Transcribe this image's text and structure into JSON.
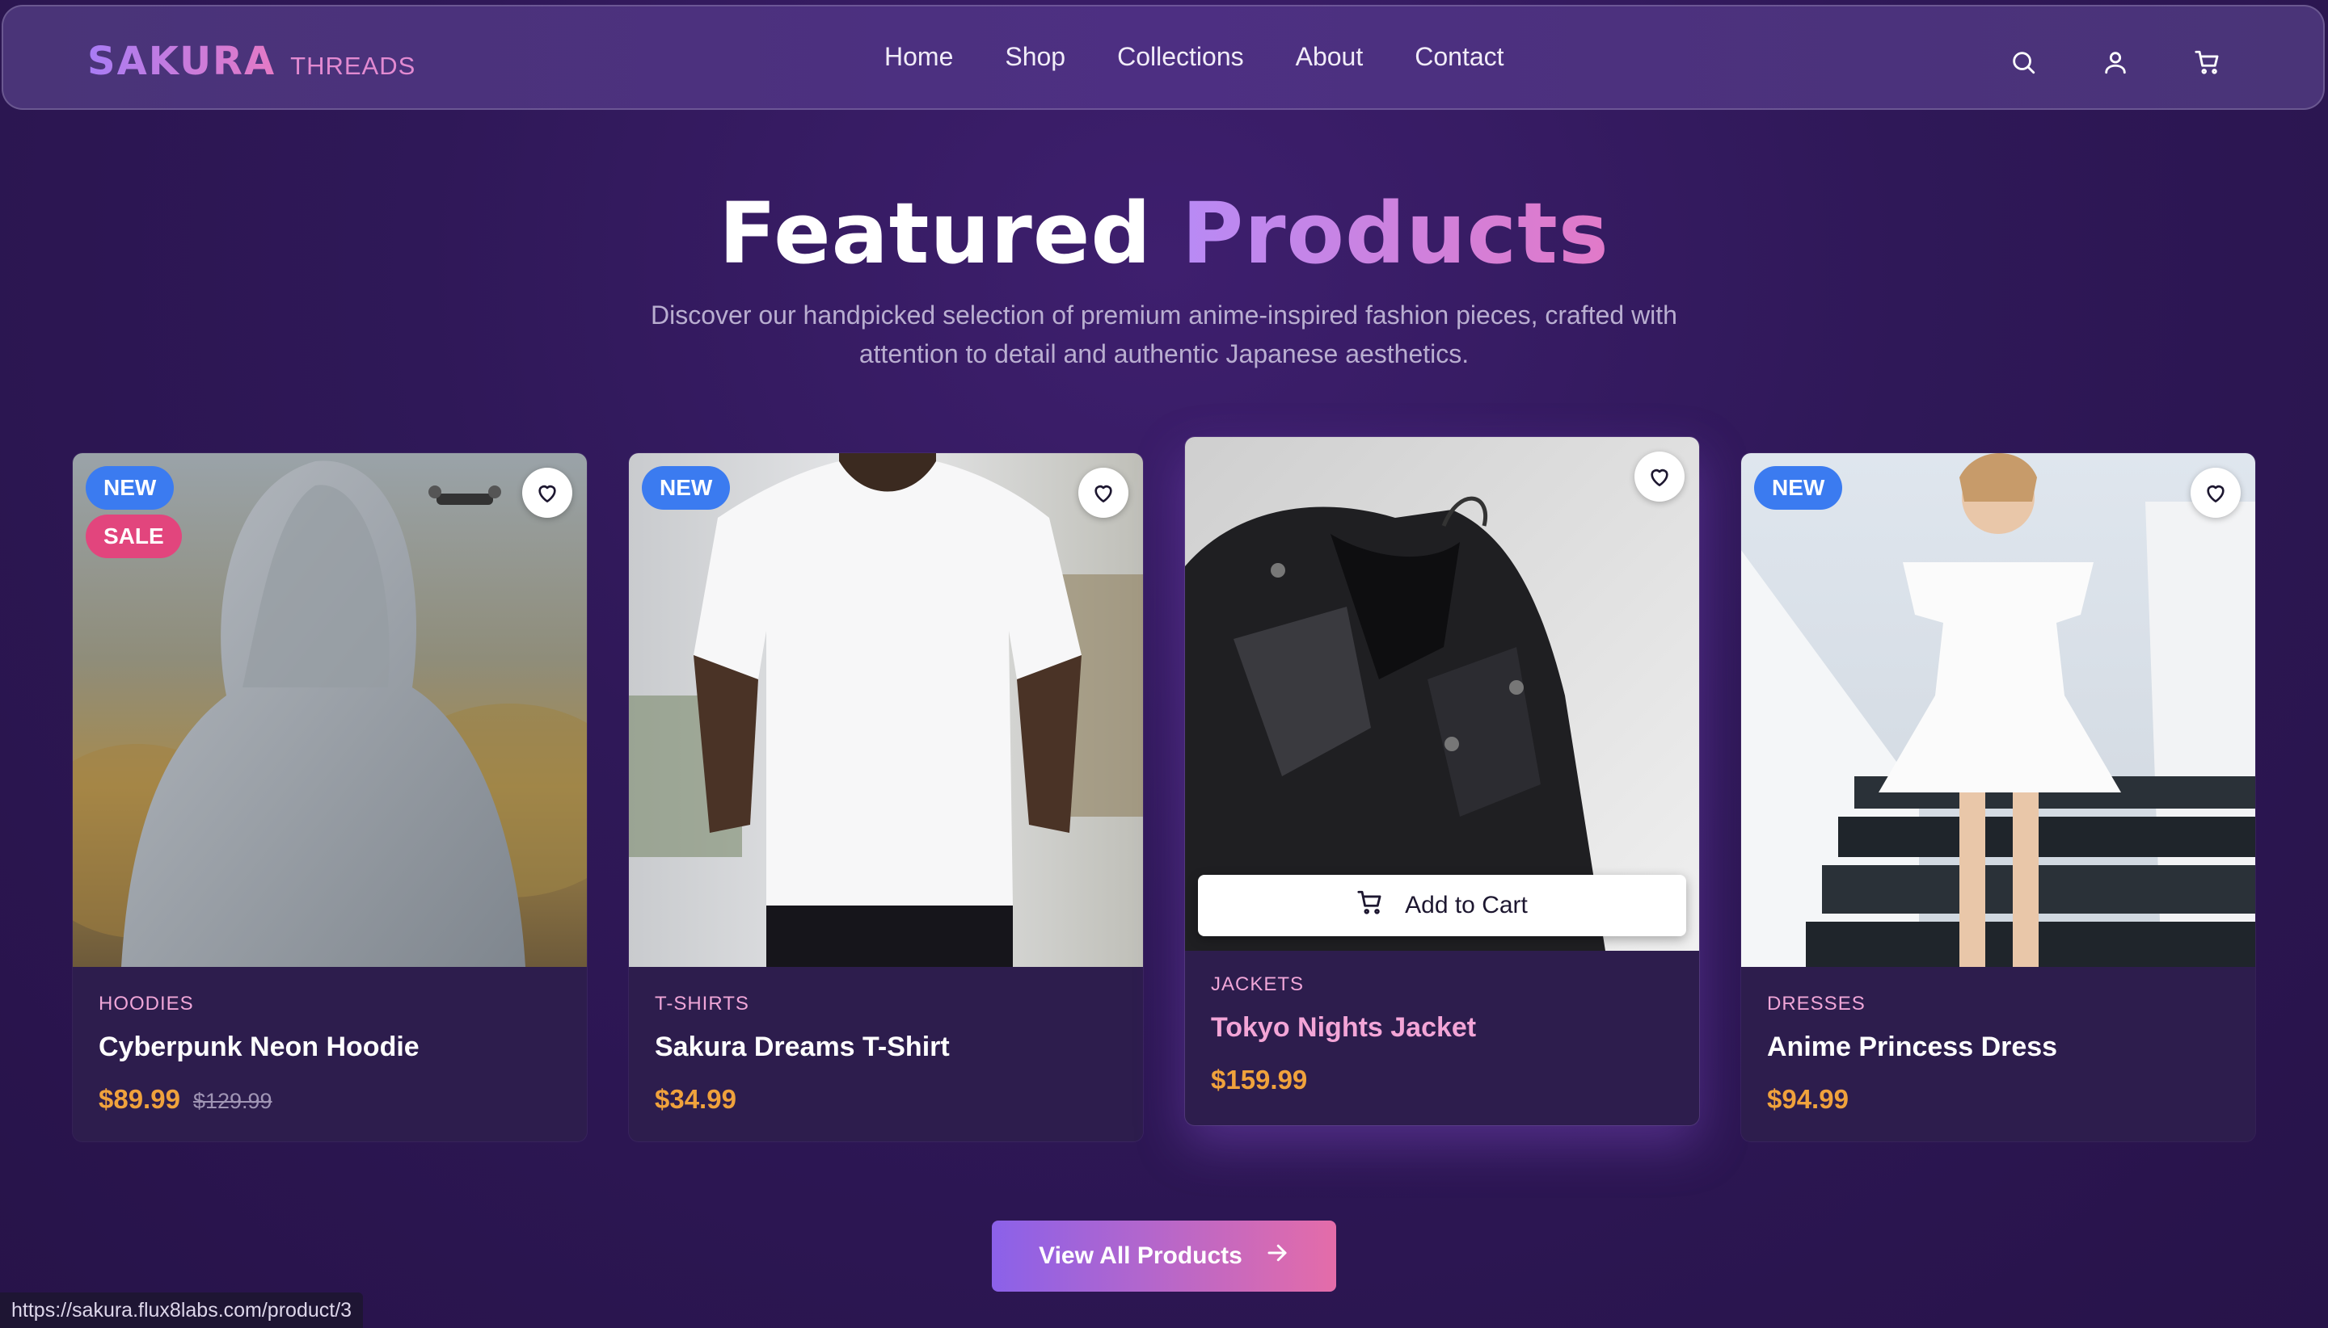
{
  "nav": {
    "logo_main": "SAKURA",
    "logo_sub": "THREADS",
    "links": [
      "Home",
      "Shop",
      "Collections",
      "About",
      "Contact"
    ],
    "icons": [
      "search-icon",
      "user-icon",
      "cart-icon"
    ]
  },
  "hero": {
    "title_white": "Featured",
    "title_gradient": "Products",
    "subtitle": "Discover our handpicked selection of premium anime-inspired fashion pieces, crafted with attention to detail and authentic Japanese aesthetics."
  },
  "products": [
    {
      "badge_new": "NEW",
      "badge_sale": "SALE",
      "category": "HOODIES",
      "name": "Cyberpunk Neon Hoodie",
      "price": "$89.99",
      "old_price": "$129.99"
    },
    {
      "badge_new": "NEW",
      "category": "T-SHIRTS",
      "name": "Sakura Dreams T-Shirt",
      "price": "$34.99"
    },
    {
      "category": "JACKETS",
      "name": "Tokyo Nights Jacket",
      "price": "$159.99",
      "add_to_cart": "Add to Cart"
    },
    {
      "badge_new": "NEW",
      "category": "DRESSES",
      "name": "Anime Princess Dress",
      "price": "$94.99"
    }
  ],
  "cta": {
    "label": "View All Products"
  },
  "status_bar": {
    "url": "https://sakura.flux8labs.com/product/3"
  },
  "colors": {
    "accent_purple": "#8b61e9",
    "accent_pink": "#e46ca9",
    "price_orange": "#f0a23c",
    "badge_new": "#3b7bf0",
    "badge_sale": "#e2457d"
  }
}
